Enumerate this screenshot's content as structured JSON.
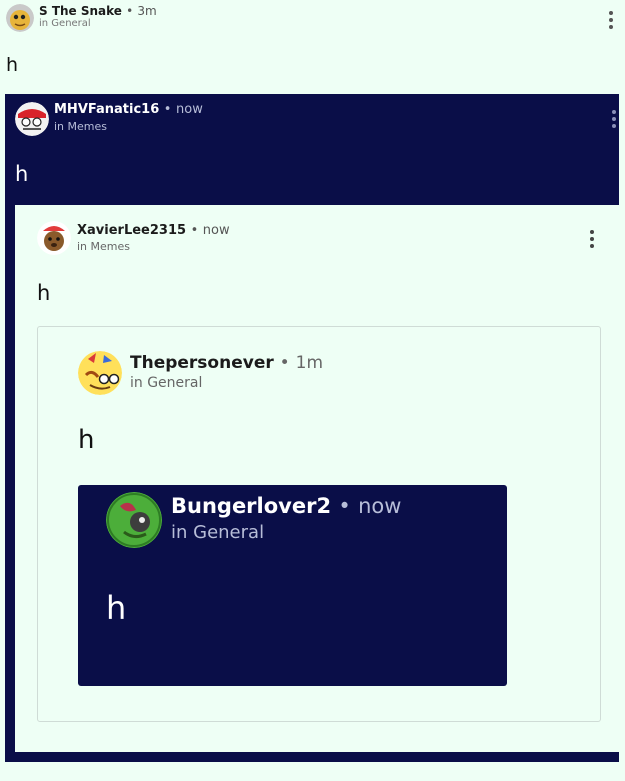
{
  "posts": [
    {
      "author": "S The Snake",
      "separator": "•",
      "time": "3m",
      "location": "in General",
      "body": "h"
    },
    {
      "author": "MHVFanatic16",
      "separator": "•",
      "time": "now",
      "location": "in Memes",
      "body": "h"
    },
    {
      "author": "XavierLee2315",
      "separator": "•",
      "time": "now",
      "location": "in Memes",
      "body": "h"
    },
    {
      "author": "Thepersonever",
      "separator": "•",
      "time": "1m",
      "location": "in General",
      "body": "h"
    },
    {
      "author": "Bungerlover2",
      "separator": "•",
      "time": "now",
      "location": "in General",
      "body": "h"
    }
  ],
  "colors": {
    "dark_card": "#0a0e48",
    "light_card": "#eefff5",
    "border": "#cfdcd6"
  },
  "icons": {
    "menu": "vertical-dots-icon"
  }
}
